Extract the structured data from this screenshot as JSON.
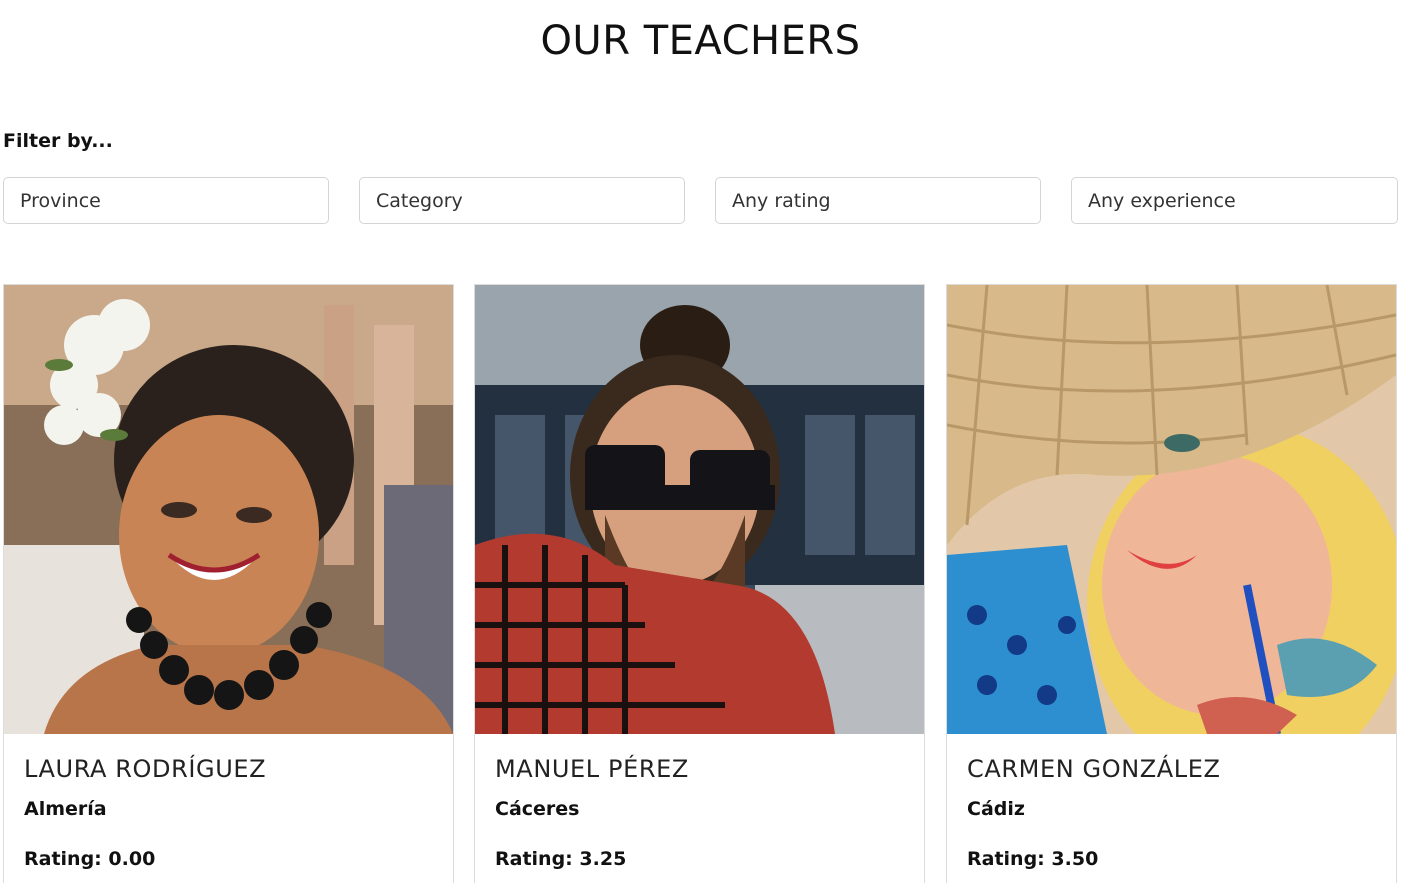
{
  "page": {
    "title": "OUR TEACHERS"
  },
  "filters": {
    "label": "Filter by...",
    "selects": [
      {
        "value": "Province"
      },
      {
        "value": "Category"
      },
      {
        "value": "Any rating"
      },
      {
        "value": "Any experience"
      }
    ]
  },
  "teachers": [
    {
      "name": "LAURA RODRÍGUEZ",
      "province": "Almería",
      "rating_label": "Rating:",
      "rating": "0.00"
    },
    {
      "name": "MANUEL PÉREZ",
      "province": "Cáceres",
      "rating_label": "Rating:",
      "rating": "3.25"
    },
    {
      "name": "CARMEN GONZÁLEZ",
      "province": "Cádiz",
      "rating_label": "Rating:",
      "rating": "3.50"
    }
  ]
}
